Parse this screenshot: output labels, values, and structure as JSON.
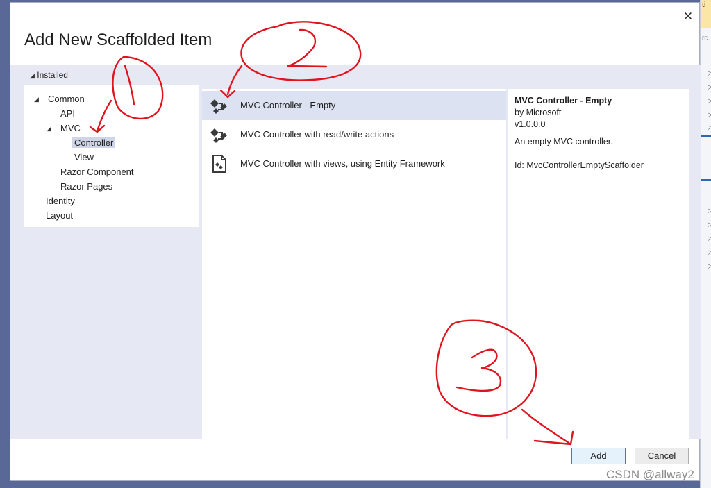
{
  "dialog": {
    "title": "Add New Scaffolded Item",
    "close_label": "✕"
  },
  "left_panel": {
    "installed_label": "Installed",
    "tree": [
      {
        "label": "Common",
        "expanded": true
      },
      {
        "label": "API"
      },
      {
        "label": "MVC",
        "expanded": true
      },
      {
        "label": "Controller",
        "selected": true
      },
      {
        "label": "View"
      },
      {
        "label": "Razor Component"
      },
      {
        "label": "Razor Pages"
      },
      {
        "label": "Identity"
      },
      {
        "label": "Layout"
      }
    ]
  },
  "items": [
    {
      "name": "MVC Controller - Empty",
      "icon": "controller-icon",
      "selected": true
    },
    {
      "name": "MVC Controller with read/write actions",
      "icon": "controller-icon"
    },
    {
      "name": "MVC Controller with views, using Entity Framework",
      "icon": "entity-framework-icon"
    }
  ],
  "detail": {
    "title": "MVC Controller - Empty",
    "author": "by Microsoft",
    "version": "v1.0.0.0",
    "description": "An empty MVC controller.",
    "id_text": "Id: MvcControllerEmptyScaffolder"
  },
  "buttons": {
    "add": "Add",
    "cancel": "Cancel"
  },
  "watermark": "CSDN @allway2",
  "annotation_color": "#e0141e"
}
